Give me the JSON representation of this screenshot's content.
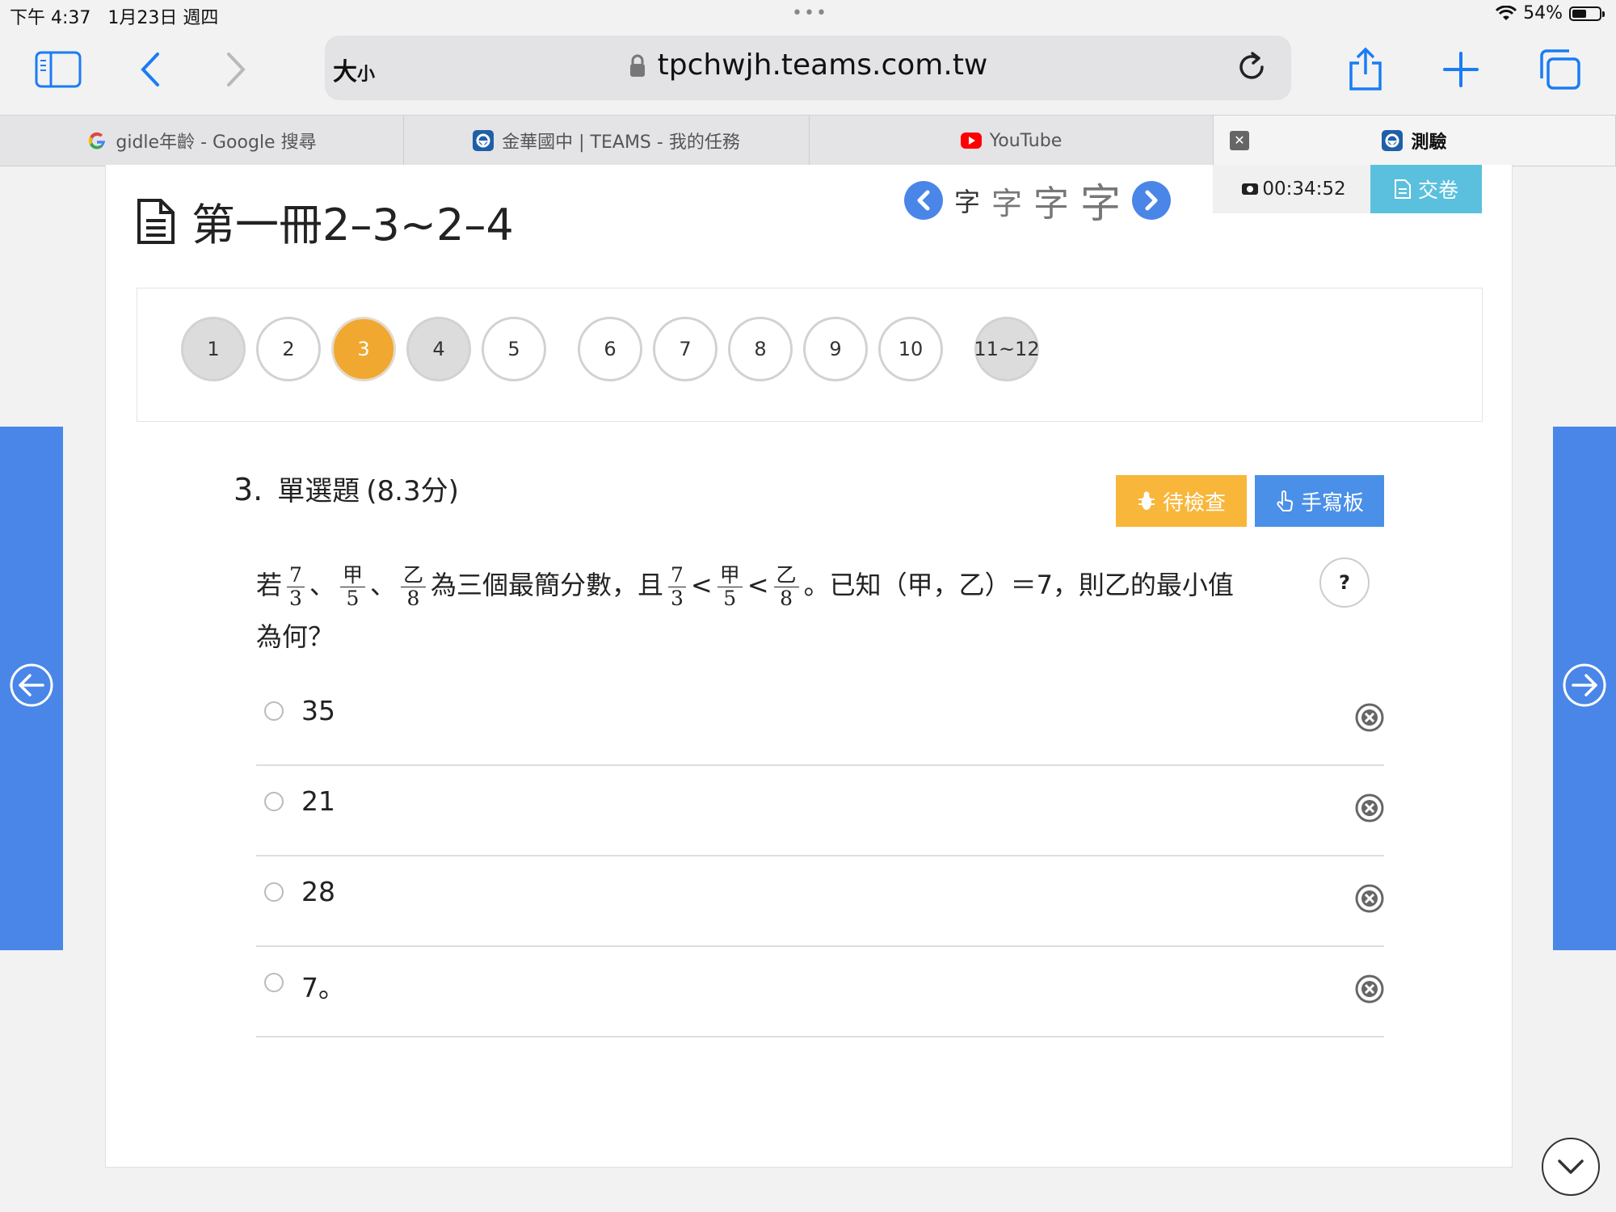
{
  "status": {
    "time": "下午 4:37",
    "date": "1月23日 週四",
    "dots": "•••",
    "battery": "54%",
    "battery_level": 0.54
  },
  "browser": {
    "size_label": "大",
    "size_label_small": "小",
    "url": "tpchwjh.teams.com.tw",
    "tabs": [
      {
        "label": "gidle年齡 - Google 搜尋",
        "favicon": "google-icon"
      },
      {
        "label": "金華國中 | TEAMS - 我的任務",
        "favicon": "teams-icon"
      },
      {
        "label": "YouTube",
        "favicon": "youtube-icon"
      },
      {
        "label": "測驗",
        "favicon": "teams-icon",
        "active": true
      }
    ]
  },
  "quiz": {
    "title": "第一冊2–3~2–4",
    "font_sizes": [
      "字",
      "字",
      "字",
      "字"
    ],
    "timer": "00:34:52",
    "submit_label": "交卷",
    "nav": [
      {
        "label": "1",
        "state": "done"
      },
      {
        "label": "2",
        "state": ""
      },
      {
        "label": "3",
        "state": "current"
      },
      {
        "label": "4",
        "state": "done"
      },
      {
        "label": "5",
        "state": ""
      },
      {
        "label": "6",
        "state": ""
      },
      {
        "label": "7",
        "state": ""
      },
      {
        "label": "8",
        "state": ""
      },
      {
        "label": "9",
        "state": ""
      },
      {
        "label": "10",
        "state": ""
      },
      {
        "label": "11~12",
        "state": "done"
      }
    ],
    "question": {
      "number": "3.",
      "type": "單選題",
      "points": "(8.3分)",
      "check_label": "待檢查",
      "pad_label": "手寫板",
      "stem": {
        "t1": "若",
        "f1n": "7",
        "f1d": "3",
        "sep1": "、",
        "f2n": "甲",
        "f2d": "5",
        "sep2": "、",
        "f3n": "乙",
        "f3d": "8",
        "t2": "為三個最簡分數，且",
        "g1n": "7",
        "g1d": "3",
        "lt1": "<",
        "g2n": "甲",
        "g2d": "5",
        "lt2": "<",
        "g3n": "乙",
        "g3d": "8",
        "t3": "。已知（甲，乙）＝7，則乙的最小值為何？"
      },
      "help": "?",
      "options": [
        "35",
        "21",
        "28",
        "7。"
      ]
    }
  }
}
